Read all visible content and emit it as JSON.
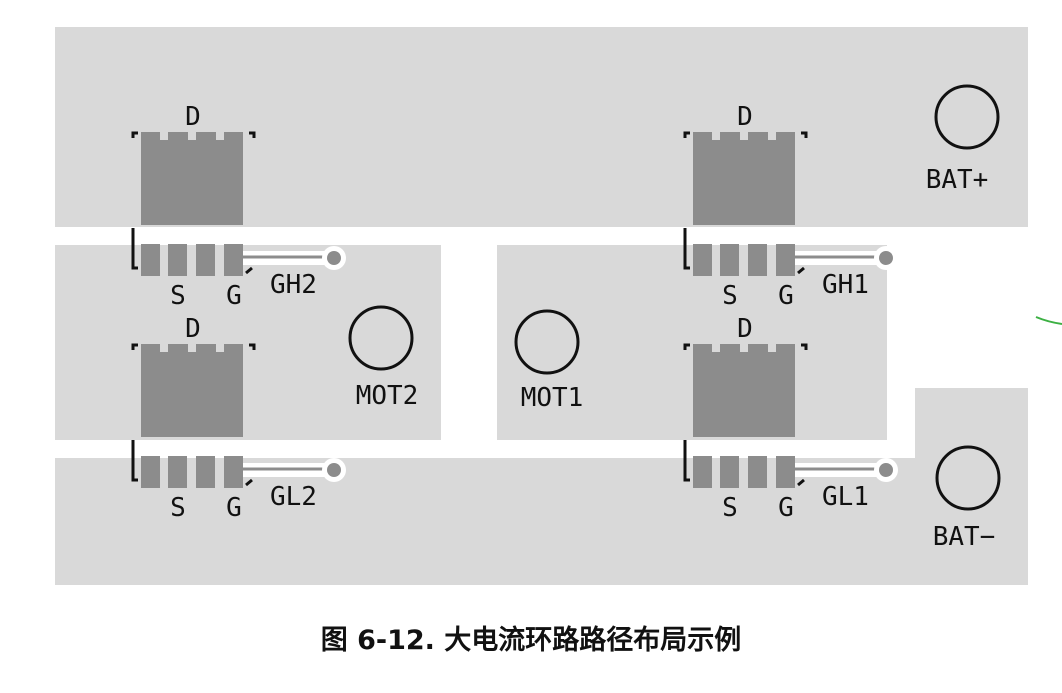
{
  "colors": {
    "copper": "#d9d9d9",
    "pad": "#8c8c8c",
    "silkscreen": "#111111",
    "trace": "#3cb043"
  },
  "mosfets": [
    {
      "drain": "D",
      "source": "S",
      "gate": "G",
      "gate_net": "GH2"
    },
    {
      "drain": "D",
      "source": "S",
      "gate": "G",
      "gate_net": "GL2"
    },
    {
      "drain": "D",
      "source": "S",
      "gate": "G",
      "gate_net": "GH1"
    },
    {
      "drain": "D",
      "source": "S",
      "gate": "G",
      "gate_net": "GL1"
    }
  ],
  "terminals": {
    "bat_plus": "BAT+",
    "bat_minus": "BAT−",
    "mot1": "MOT1",
    "mot2": "MOT2"
  },
  "caption": "图 6-12. 大电流环路路径布局示例"
}
